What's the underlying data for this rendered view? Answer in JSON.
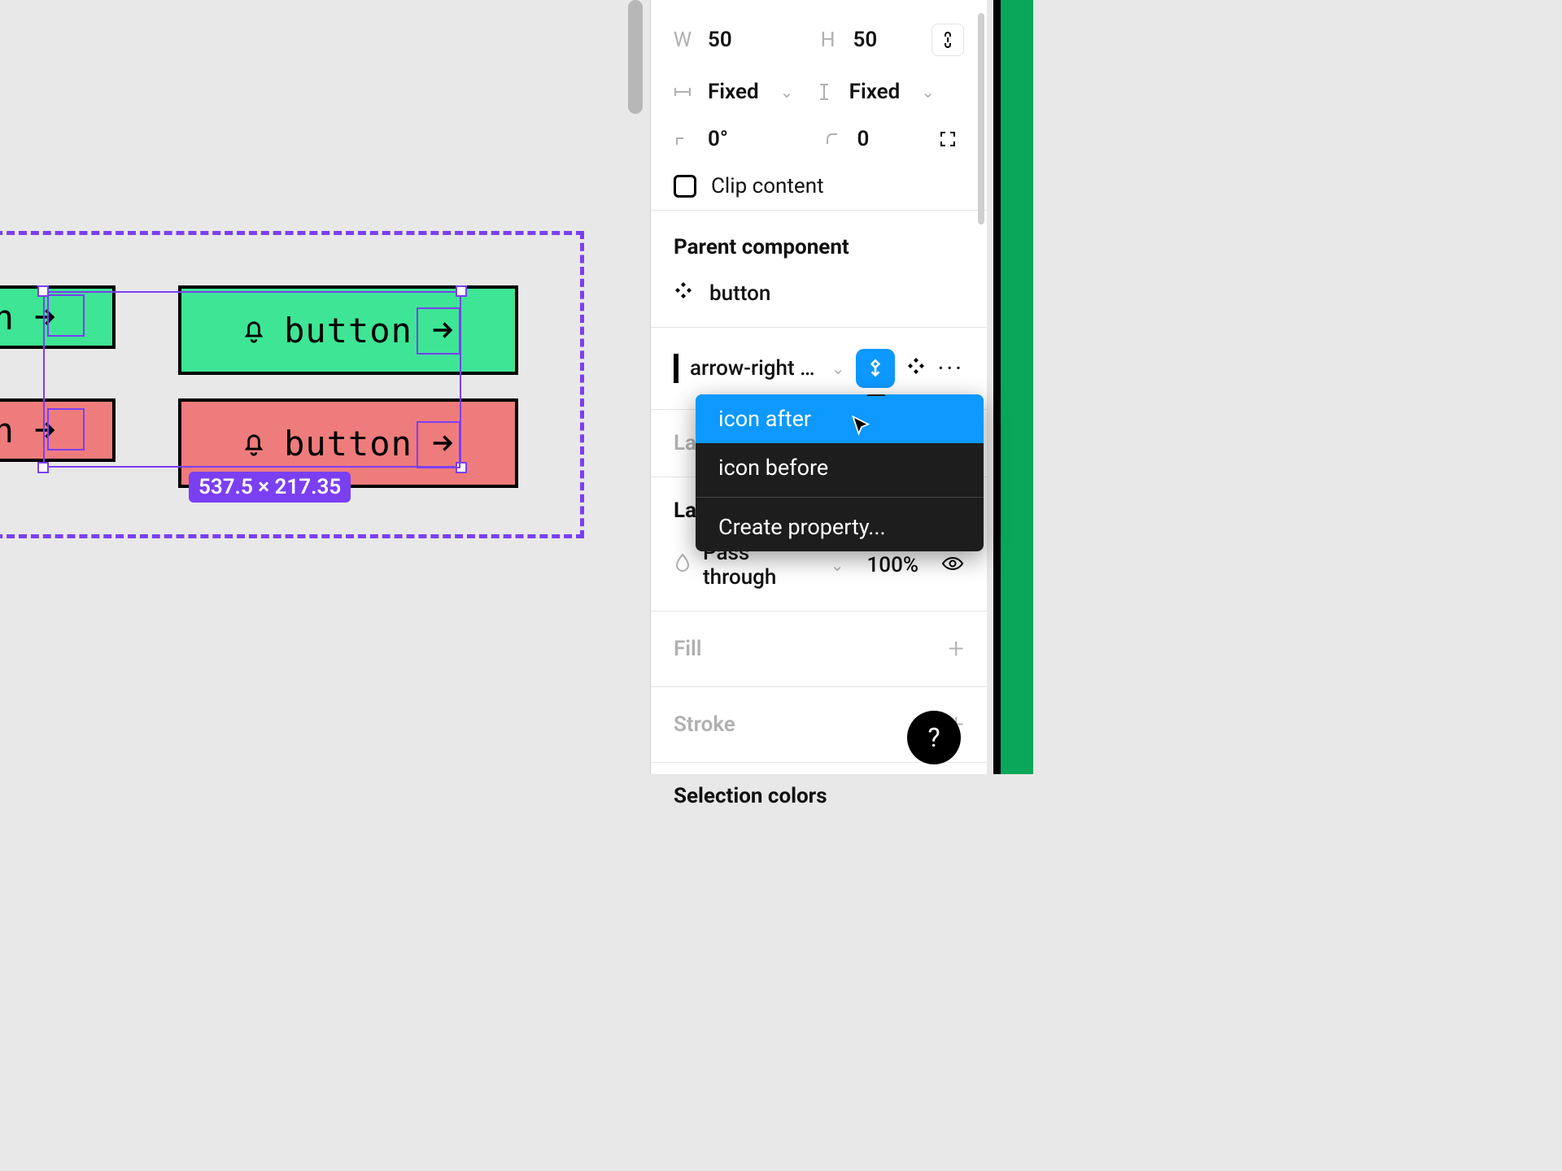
{
  "canvas": {
    "buttons": {
      "label": "button"
    },
    "selection_dimensions": "537.5 × 217.35"
  },
  "panel": {
    "size": {
      "w_label": "W",
      "w_value": "50",
      "h_label": "H",
      "h_value": "50"
    },
    "resize": {
      "horizontal": "Fixed",
      "vertical": "Fixed"
    },
    "rotation": "0°",
    "corner": "0",
    "clip_content_label": "Clip content",
    "parent": {
      "title": "Parent component",
      "name": "button"
    },
    "instance": {
      "name": "arrow-right …"
    },
    "auto_layout_truncated": "Lay",
    "layer_section_truncated": "Lay",
    "layer": {
      "blend": "Pass through",
      "opacity": "100%"
    },
    "fill_title": "Fill",
    "stroke_title": "Stroke",
    "selection_colors_title": "Selection colors"
  },
  "dropdown": {
    "items": [
      "icon after",
      "icon before"
    ],
    "create": "Create property..."
  },
  "help_label": "?",
  "colors": {
    "accent_blue": "#0d99ff",
    "selection_purple": "#7b3ff2",
    "button_green": "#3ee594",
    "button_red": "#ef7c7c",
    "brand_green": "#0aa75a"
  }
}
